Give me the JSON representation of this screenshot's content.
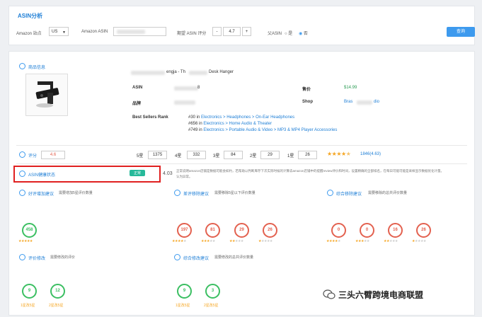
{
  "header": {
    "title": "ASIN分析",
    "site_label": "Amazon 站点",
    "site_value": "US",
    "asin_label": "Amazon ASIN",
    "score_label": "期望 ASIN 评分",
    "score_value": "4.7",
    "minus": "-",
    "plus": "+",
    "parent_label": "父ASIN",
    "opt_yes": "是",
    "opt_no": "否",
    "query": "查询"
  },
  "product": {
    "section": "商品信息",
    "title_a": "engja - Th",
    "title_b": "Desk Hanger",
    "asin_label": "ASIN",
    "asin_tail": "8",
    "price_label": "售价",
    "price": "$14.99",
    "brand_label": "品牌",
    "shop_label": "Shop",
    "shop_a": "Bras",
    "shop_b": "dio",
    "bsr_label": "Best Sellers Rank",
    "ranks": [
      {
        "rank": "#30 in",
        "path": "Electronics > Headphones > On-Ear Headphones"
      },
      {
        "rank": "#656 in",
        "path": "Electronics > Home Audio & Theater"
      },
      {
        "rank": "#749 in",
        "path": "Electronics > Portable Audio & Video > MP3 & MP4 Player Accessories"
      }
    ]
  },
  "rating": {
    "label": "评分",
    "value": "4.6",
    "s5": "5星",
    "v5": "1375",
    "s4": "4星",
    "v4": "332",
    "s3": "3星",
    "v3": "84",
    "s2": "2星",
    "v2": "29",
    "s1": "1星",
    "v1": "26",
    "total": "1846(4.63)"
  },
  "health": {
    "label": "ASIN健康状态",
    "badge": "正常",
    "score": "4.03",
    "desc": "正常说明amazon店铺是数据可能会如约，若帮助以判断库存下次实际时候的计算去amazon店铺中的提醒review评价和时间，设置精确的全部排名，在每日可能可能是采样显示数据优化计量。",
    "desc2": "认为异常。"
  },
  "sugg": {
    "add": "好评增加建议",
    "add_hint": "需要增加5星评价数量",
    "remove": "差评移除建议",
    "remove_hint": "需要移除5星以下评价数量",
    "comp_remove": "综合移除建议",
    "comp_remove_hint": "需要移除的总共评价数量",
    "modify": "评价修改",
    "modify_hint": "需要修改的评价",
    "comp_modify": "综合修改建议",
    "comp_modify_hint": "需要修改的总共评价数量",
    "add_val": "458",
    "remove_vals": [
      "197",
      "81",
      "29",
      "26"
    ],
    "comp_vals": [
      "0",
      "0",
      "16",
      "26"
    ],
    "mod_vals": [
      "9",
      "12"
    ],
    "mod_labels": [
      "1星改5星",
      "2星改5星"
    ],
    "cmod_vals": [
      "9",
      "3"
    ],
    "cmod_labels": [
      "1星改5星",
      "2星改5星"
    ]
  },
  "watermark": "三头六臂跨境电商联盟"
}
